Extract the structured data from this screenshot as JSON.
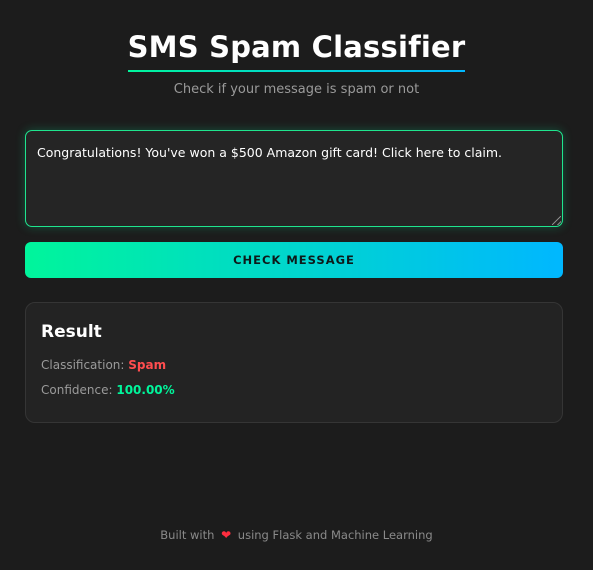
{
  "header": {
    "title": "SMS Spam Classifier",
    "subtitle": "Check if your message is spam or not"
  },
  "input": {
    "message": "Congratulations! You've won a $500 Amazon gift card! Click here to claim."
  },
  "actions": {
    "check_label": "CHECK MESSAGE"
  },
  "result": {
    "heading": "Result",
    "classification_label": "Classification:",
    "classification_value": "Spam",
    "confidence_label": "Confidence:",
    "confidence_value": "100.00%"
  },
  "footer": {
    "prefix": "Built with",
    "icon": "heart-icon",
    "suffix": "using Flask and Machine Learning"
  },
  "colors": {
    "background": "#1c1c1c",
    "accent_start": "#00f59b",
    "accent_end": "#00b7ff",
    "spam": "#ff4d4f",
    "confidence": "#00f59b"
  }
}
